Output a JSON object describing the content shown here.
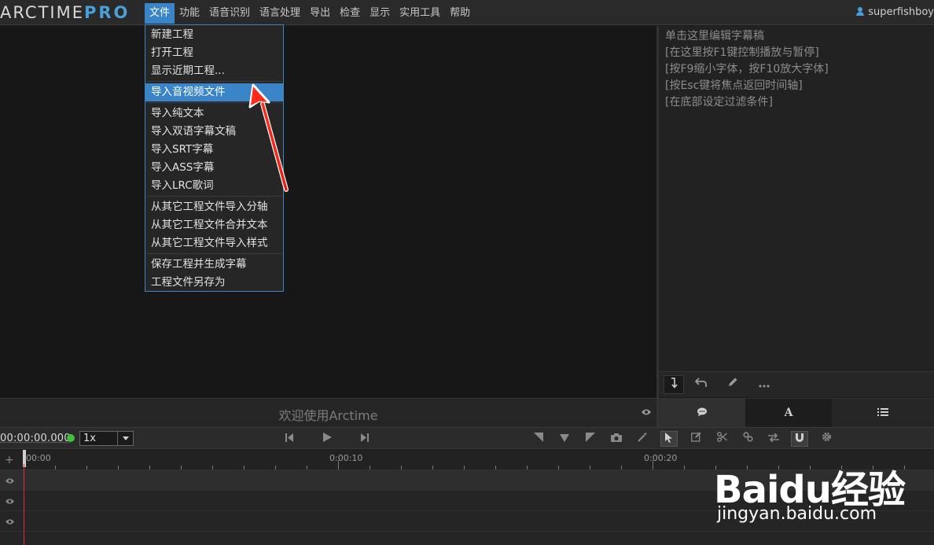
{
  "app": {
    "logo_left": "ARCTIME",
    "logo_right": "PRO",
    "accent_color": "#3a85c7",
    "user_name": "superfishboy",
    "user_icon": "user-icon"
  },
  "menubar": {
    "items": [
      {
        "label": "文件",
        "active": true
      },
      {
        "label": "功能"
      },
      {
        "label": "语音识别"
      },
      {
        "label": "语言处理"
      },
      {
        "label": "导出"
      },
      {
        "label": "检查"
      },
      {
        "label": "显示"
      },
      {
        "label": "实用工具"
      },
      {
        "label": "帮助"
      }
    ]
  },
  "file_menu": {
    "items": [
      {
        "label": "新建工程"
      },
      {
        "label": "打开工程"
      },
      {
        "label": "显示近期工程..."
      },
      {
        "label": "导入音视频文件",
        "highlighted": true
      },
      {
        "label": "导入纯文本"
      },
      {
        "label": "导入双语字幕文稿"
      },
      {
        "label": "导入SRT字幕"
      },
      {
        "label": "导入ASS字幕"
      },
      {
        "label": "导入LRC歌词"
      },
      {
        "label": "从其它工程文件导入分轴"
      },
      {
        "label": "从其它工程文件合并文本"
      },
      {
        "label": "从其它工程文件导入样式"
      },
      {
        "label": "保存工程并生成字幕"
      },
      {
        "label": "工程文件另存为"
      }
    ]
  },
  "subtitle_editor": {
    "hint_lines": [
      "单击这里编辑字幕稿",
      "[在这里按F1键控制播放与暂停]",
      "[按F9缩小字体，按F10放大字体]",
      "[按Esc键将焦点返回时间轴]",
      "[在底部设定过滤条件]"
    ],
    "toolbar_icons": [
      "insert-line-icon",
      "undo-icon",
      "pencil-icon",
      "more-icon"
    ],
    "tabs": [
      {
        "icon": "chat-bubble-icon",
        "active": true
      },
      {
        "label": "A",
        "icon": "font-style-icon"
      },
      {
        "icon": "list-icon"
      }
    ]
  },
  "preview": {
    "welcome_text": "欢迎使用Arctime",
    "eye_icon": "eye-icon"
  },
  "playback": {
    "timecode": "00:00:00.000",
    "speed": "1x",
    "status_color": "#3ec23e",
    "controls": [
      "skip-start-icon",
      "play-icon",
      "skip-end-icon"
    ],
    "tools": [
      "mark-in-icon",
      "mark-down-icon",
      "mark-out-icon",
      "camera-icon",
      "magic-wand-icon",
      "pointer-icon",
      "edit-icon",
      "scissors-icon",
      "link-icon",
      "swap-icon",
      "magnet-icon",
      "gear-icon"
    ]
  },
  "timeline": {
    "ruler_labels": [
      "00:00",
      "0:00:10",
      "0:00:20"
    ],
    "playhead_color": "#e0302a"
  },
  "watermark": {
    "brand": "Baidu经验",
    "url": "jingyan.baidu.com"
  }
}
